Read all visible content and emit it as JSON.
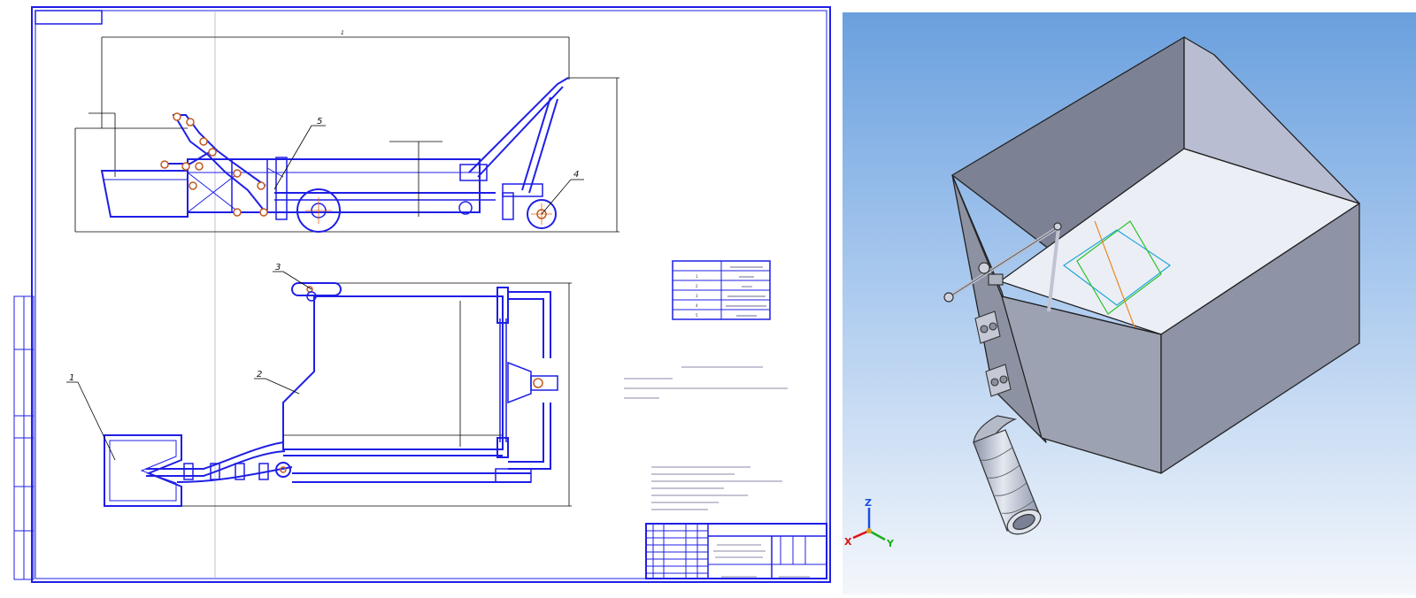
{
  "drawing": {
    "format_label": "",
    "title_block_title": "",
    "callouts": {
      "c1": "1",
      "c2": "2",
      "c3": "3",
      "c4": "4",
      "c5": "5"
    },
    "spec_table_rows": [
      "",
      "1",
      "2",
      "3",
      "4",
      "5"
    ],
    "tech_heading": "",
    "notes_heading": ""
  },
  "model": {
    "axes": {
      "x": "X",
      "y": "Y",
      "z": "Z"
    }
  },
  "colors": {
    "drawing_blue": "#1f1fe6",
    "viewport_top": "#6aa0de",
    "viewport_bottom": "#f4f7fb",
    "axis_x": "#e01010",
    "axis_y": "#18b018",
    "axis_z": "#1a50e0"
  }
}
